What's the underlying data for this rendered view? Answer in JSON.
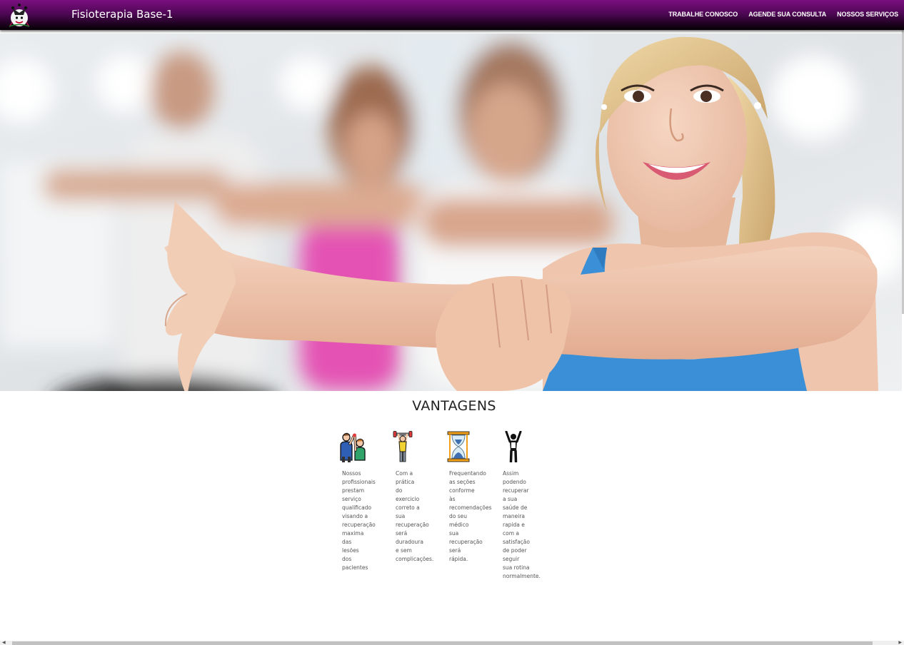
{
  "header": {
    "brand": "Fisioterapia Base-1",
    "nav": [
      "TRABALHE CONOSCO",
      "AGENDE SUA CONSULTA",
      "NOSSOS SERVIÇOS"
    ],
    "logo_icon": "jester-logo-icon"
  },
  "hero": {
    "image": "woman-stretching-arm-gym-class-photo"
  },
  "vantagens": {
    "title": "VANTAGENS",
    "items": [
      {
        "icon": "professionals-high-five-icon",
        "text": "Nossos\nprofissionais\nprestam\nserviço\nqualificado\nvisando a\nrecuperação\nmaxima\ndas\nlesões\ndos\npacientes"
      },
      {
        "icon": "weightlifter-icon",
        "text": "Com a\nprática\ndo\nexercicio\ncorreto a\nsua\nrecuperação\nserá\nduradoura\ne sem\ncomplicações."
      },
      {
        "icon": "hourglass-icon",
        "text": "Frequentando\nas seções\nconforme\nàs\nrecomendações\ndo seu\nmédico\nsua\nrecuperação\nserá\nrápida."
      },
      {
        "icon": "person-arms-up-icon",
        "text": "Assim\npodendo\nrecuperar\na sua\nsaúde de\nmaneira\nrapida e\ncom a\nsatisfação\nde poder\nseguir\nsua rotina\nnormalmente."
      }
    ]
  },
  "colors": {
    "header_top": "#7a1080",
    "header_bottom": "#050005",
    "title_text": "#222222",
    "body_text": "#555555",
    "top_blue": "#3a8fd6"
  }
}
